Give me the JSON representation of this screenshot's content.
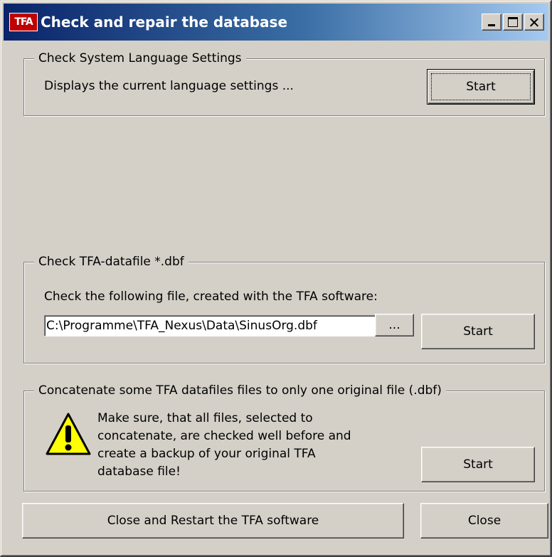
{
  "window": {
    "icon_text": "TFA",
    "title": "Check and repair the database"
  },
  "language_group": {
    "legend": "Check System Language Settings",
    "description": "Displays the current language settings ...",
    "start_label": "Start"
  },
  "datafile_group": {
    "legend": "Check TFA-datafile *.dbf",
    "description": "Check the following file, created with the TFA software:",
    "file_path": "C:\\Programme\\TFA_Nexus\\Data\\SinusOrg.dbf",
    "browse_label": "...",
    "start_label": "Start"
  },
  "concat_group": {
    "legend": "Concatenate some TFA datafiles files to only one original file (.dbf)",
    "warning_lines": [
      "Make sure, that all files, selected to",
      "concatenate, are checked well before and",
      "create a backup of your original TFA",
      "database file!"
    ],
    "start_label": "Start",
    "icon": "warning-icon"
  },
  "footer": {
    "restart_label": "Close and Restart the TFA software",
    "close_label": "Close"
  },
  "colors": {
    "face": "#d4d0c8",
    "title_gradient_start": "#0a246a",
    "title_gradient_end": "#a6caf0",
    "warning_yellow": "#ffff00"
  }
}
